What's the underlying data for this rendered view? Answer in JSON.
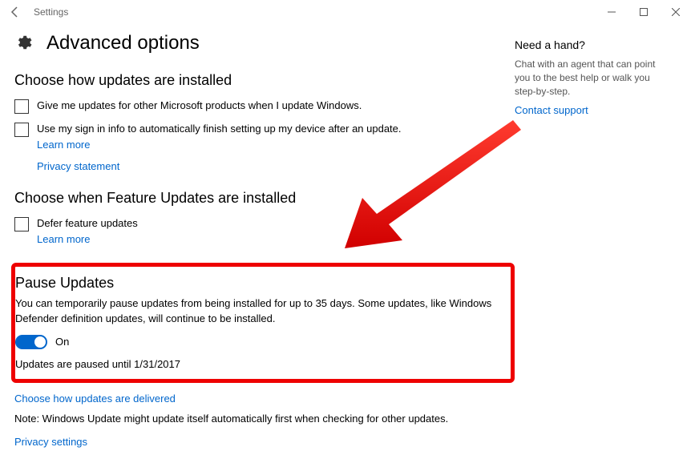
{
  "titlebar": {
    "app_name": "Settings"
  },
  "header": {
    "title": "Advanced options"
  },
  "section_install": {
    "heading": "Choose how updates are installed",
    "cb1_label": "Give me updates for other Microsoft products when I update Windows.",
    "cb2_label": "Use my sign in info to automatically finish setting up my device after an update.",
    "learn_more": "Learn more",
    "privacy_link": "Privacy statement"
  },
  "section_feature": {
    "heading": "Choose when Feature Updates are installed",
    "cb_label": "Defer feature updates",
    "learn_more": "Learn more"
  },
  "section_pause": {
    "heading": "Pause Updates",
    "desc": "You can temporarily pause updates from being installed for up to 35 days. Some updates, like Windows Defender definition updates, will continue to be installed.",
    "toggle_label": "On",
    "status": "Updates are paused until 1/31/2017"
  },
  "footer": {
    "delivery_link": "Choose how updates are delivered",
    "note": "Note: Windows Update might update itself automatically first when checking for other updates.",
    "privacy_link": "Privacy settings"
  },
  "side": {
    "heading": "Need a hand?",
    "text": "Chat with an agent that can point you to the best help or walk you step-by-step.",
    "link": "Contact support"
  }
}
